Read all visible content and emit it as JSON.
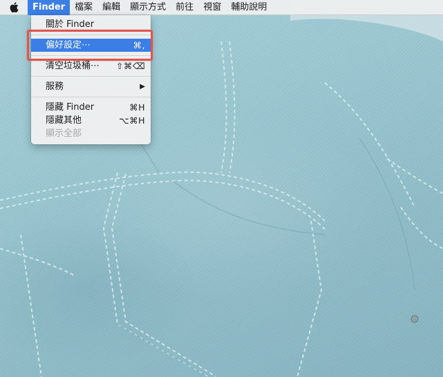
{
  "menubar": {
    "apple_icon": "apple-icon",
    "menus": [
      {
        "label": "Finder"
      },
      {
        "label": "檔案"
      },
      {
        "label": "編輯"
      },
      {
        "label": "顯示方式"
      },
      {
        "label": "前往"
      },
      {
        "label": "視窗"
      },
      {
        "label": "輔助說明"
      }
    ]
  },
  "finder_menu": {
    "about": {
      "label": "關於 Finder"
    },
    "preferences": {
      "label": "偏好設定⋯",
      "shortcut": "⌘,"
    },
    "empty_trash": {
      "label": "清空垃圾桶⋯",
      "shortcut": "⇧⌘⌫"
    },
    "services": {
      "label": "服務",
      "arrow": "▶"
    },
    "hide_finder": {
      "label": "隱藏 Finder",
      "shortcut": "⌘H"
    },
    "hide_others": {
      "label": "隱藏其他",
      "shortcut": "⌥⌘H"
    },
    "show_all": {
      "label": "顯示全部"
    }
  },
  "colors": {
    "selection": "#3b7ee6",
    "annotation": "#e0564e",
    "menu_background": "#eef0f1"
  }
}
